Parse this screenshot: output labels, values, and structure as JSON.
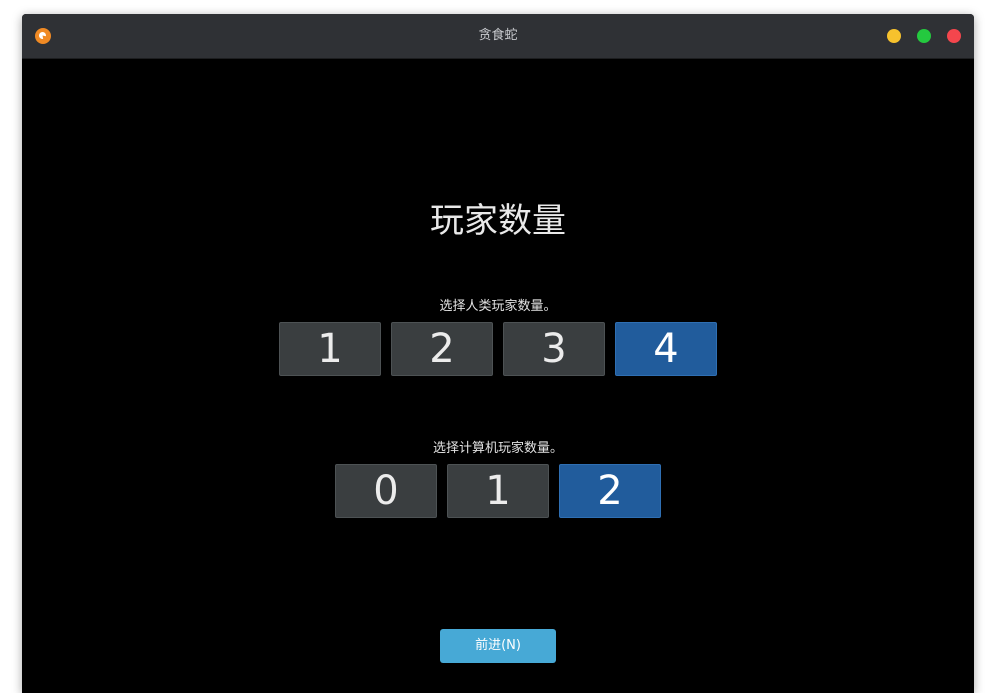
{
  "window": {
    "title": "贪食蛇",
    "controls": {
      "minimize_color": "#f7c22d",
      "maximize_color": "#24c93f",
      "close_color": "#f4464d"
    },
    "app_icon": "snake-game-icon"
  },
  "main": {
    "heading": "玩家数量",
    "human_players": {
      "label": "选择人类玩家数量。",
      "options": [
        "1",
        "2",
        "3",
        "4"
      ],
      "selected": "4"
    },
    "computer_players": {
      "label": "选择计算机玩家数量。",
      "options": [
        "0",
        "1",
        "2"
      ],
      "selected": "2"
    },
    "next_button_label": "前进(N)"
  },
  "colors": {
    "background": "#000000",
    "titlebar": "#2f3135",
    "button": "#3a3e40",
    "button_selected": "#215c9c",
    "accent": "#47a9d6"
  }
}
